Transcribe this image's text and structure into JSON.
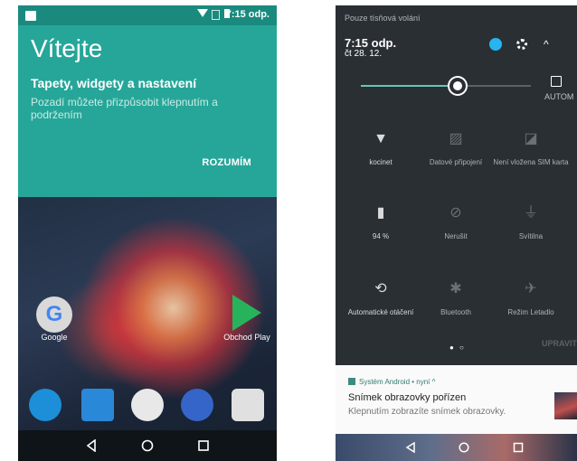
{
  "left": {
    "status_time": "7:15 odp.",
    "welcome_title": "Vítejte",
    "welcome_subtitle": "Tapety, widgety a nastavení",
    "welcome_desc": "Pozadí můžete přizpůsobit klepnutím a podržením",
    "ok_button": "ROZUMÍM",
    "apps": [
      {
        "label": "Google",
        "icon": "google-icon"
      },
      {
        "label": "Obchod Play",
        "icon": "play-store-icon"
      }
    ],
    "dock_icons": [
      "phone-icon",
      "contacts-icon",
      "app-drawer-icon",
      "messages-icon",
      "camera-icon"
    ],
    "nav_icons": [
      "back-icon",
      "home-icon",
      "recents-icon"
    ]
  },
  "right": {
    "emergency": "Pouze tísňová volání",
    "time": "7:15 odp.",
    "date": "čt 28. 12.",
    "brightness_percent": 57,
    "auto_label": "AUTOM",
    "tiles": [
      {
        "label": "kocinet",
        "icon": "wifi-icon",
        "active": true
      },
      {
        "label": "Datové připojení",
        "icon": "mobile-data-icon",
        "active": false
      },
      {
        "label": "Není vložena SIM karta",
        "icon": "no-sim-icon",
        "active": false
      },
      {
        "label": "94 %",
        "icon": "battery-icon",
        "active": true
      },
      {
        "label": "Nerušit",
        "icon": "do-not-disturb-icon",
        "active": false
      },
      {
        "label": "Svítilna",
        "icon": "flashlight-icon",
        "active": false
      },
      {
        "label": "Automatické otáčení",
        "icon": "auto-rotate-icon",
        "active": true
      },
      {
        "label": "Bluetooth",
        "icon": "bluetooth-icon",
        "active": false
      },
      {
        "label": "Režim Letadlo",
        "icon": "airplane-icon",
        "active": false
      }
    ],
    "edit_label": "UPRAVIT",
    "notification": {
      "header": "Systém Android • nyní ^",
      "title": "Snímek obrazovky pořízen",
      "body": "Klepnutím zobrazíte snímek obrazovky."
    },
    "colors": {
      "accent": "#26a699",
      "panel": "#2a2f34",
      "user": "#25b6f2"
    }
  }
}
